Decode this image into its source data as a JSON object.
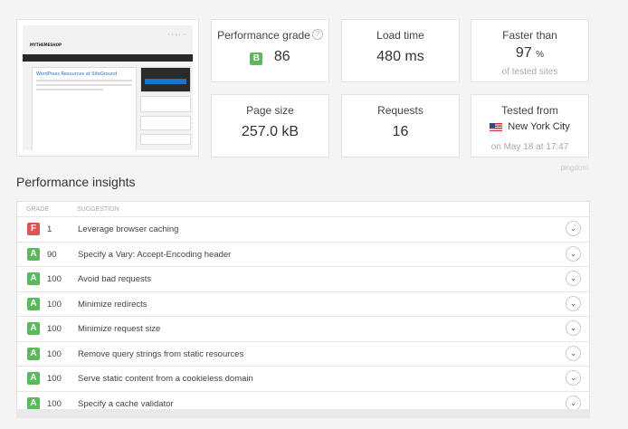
{
  "screenshot": {
    "brand": "MYTHEMESHOP",
    "post_title": "WordPress Resources at SiteGround",
    "top_icons": "f t g+ in"
  },
  "metrics": {
    "performance_grade": {
      "label": "Performance grade",
      "grade": "B",
      "score": "86"
    },
    "load_time": {
      "label": "Load time",
      "value": "480 ms"
    },
    "faster_than": {
      "label": "Faster than",
      "value": "97",
      "unit": "%",
      "sub": "of tested sites"
    },
    "page_size": {
      "label": "Page size",
      "value": "257.0 kB"
    },
    "requests": {
      "label": "Requests",
      "value": "16"
    },
    "tested_from": {
      "label": "Tested from",
      "location": "New York City",
      "date": "on May 18 at 17:47"
    }
  },
  "watermark": "pingdom",
  "insights": {
    "title": "Performance insights",
    "col_grade": "GRADE",
    "col_suggestion": "SUGGESTION",
    "rows": [
      {
        "grade": "F",
        "score": "1",
        "suggestion": "Leverage browser caching",
        "color": "#e05353"
      },
      {
        "grade": "A",
        "score": "90",
        "suggestion": "Specify a Vary: Accept-Encoding header",
        "color": "#5cb85c"
      },
      {
        "grade": "A",
        "score": "100",
        "suggestion": "Avoid bad requests",
        "color": "#5cb85c"
      },
      {
        "grade": "A",
        "score": "100",
        "suggestion": "Minimize redirects",
        "color": "#5cb85c"
      },
      {
        "grade": "A",
        "score": "100",
        "suggestion": "Minimize request size",
        "color": "#5cb85c"
      },
      {
        "grade": "A",
        "score": "100",
        "suggestion": "Remove query strings from static resources",
        "color": "#5cb85c"
      },
      {
        "grade": "A",
        "score": "100",
        "suggestion": "Serve static content from a cookieless domain",
        "color": "#5cb85c"
      },
      {
        "grade": "A",
        "score": "100",
        "suggestion": "Specify a cache validator",
        "color": "#5cb85c"
      }
    ]
  },
  "icons": {
    "help": "help-icon",
    "expand": "chevron-down-icon",
    "flag": "us-flag-icon"
  }
}
